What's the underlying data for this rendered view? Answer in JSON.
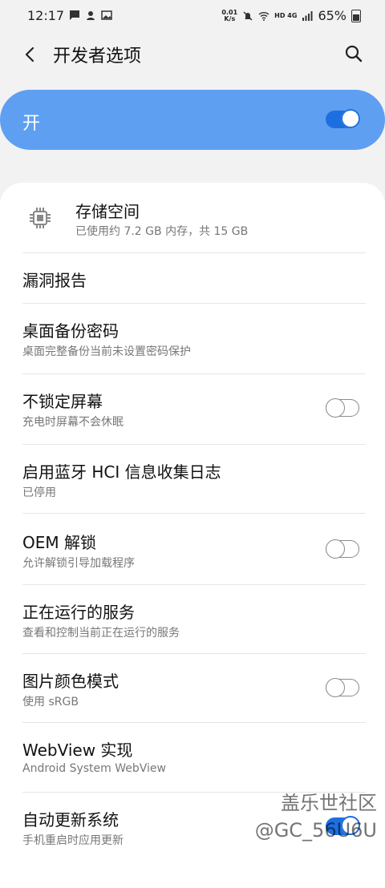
{
  "status_bar": {
    "time": "12:17",
    "net_speed_value": "0.01",
    "net_speed_unit": "K/s",
    "network": "HD 4G",
    "battery": "65%"
  },
  "header": {
    "title": "开发者选项"
  },
  "master_switch": {
    "label": "开",
    "state": true
  },
  "items": [
    {
      "title": "存储空间",
      "subtitle": "已使用约 7.2 GB 内存，共 15 GB",
      "icon": "chip-icon"
    },
    {
      "title": "漏洞报告"
    },
    {
      "title": "桌面备份密码",
      "subtitle": "桌面完整备份当前未设置密码保护"
    },
    {
      "title": "不锁定屏幕",
      "subtitle": "充电时屏幕不会休眠",
      "toggle": false
    },
    {
      "title": "启用蓝牙 HCI 信息收集日志",
      "subtitle": "已停用"
    },
    {
      "title": "OEM 解锁",
      "subtitle": "允许解锁引导加载程序",
      "toggle": false
    },
    {
      "title": "正在运行的服务",
      "subtitle": "查看和控制当前正在运行的服务"
    },
    {
      "title": "图片颜色模式",
      "subtitle": "使用 sRGB",
      "toggle": false
    },
    {
      "title": "WebView 实现",
      "subtitle": "Android System WebView"
    },
    {
      "title": "自动更新系统",
      "subtitle": "手机重启时应用更新",
      "toggle": true
    }
  ],
  "watermark": {
    "line1": "盖乐世社区",
    "line2": "@GC_56U6U"
  },
  "colors": {
    "accent": "#5e9ff1",
    "toggle_on": "#1d6fe0",
    "background": "#f2f2f2"
  }
}
